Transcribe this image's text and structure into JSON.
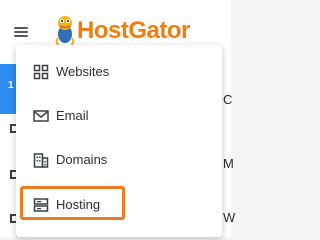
{
  "header": {
    "brand": "HostGator"
  },
  "sidebar": {
    "active_badge": "1"
  },
  "right_panel": {
    "fragments": [
      "C",
      "M",
      "W"
    ]
  },
  "menu": {
    "items": [
      {
        "label": "Websites",
        "icon": "grid-icon"
      },
      {
        "label": "Email",
        "icon": "envelope-icon"
      },
      {
        "label": "Domains",
        "icon": "building-icon"
      },
      {
        "label": "Hosting",
        "icon": "server-icon",
        "highlighted": true
      }
    ]
  },
  "colors": {
    "brand": "#f27d0c",
    "highlight_border": "#ee7a22",
    "active_sidebar": "#2d8cf0"
  }
}
